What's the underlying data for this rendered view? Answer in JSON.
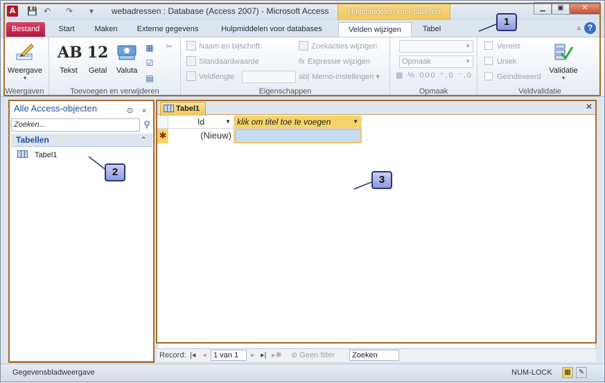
{
  "titlebar": {
    "app_icon": "A",
    "title": "webadressen : Database (Access 2007)  -  Microsoft Access",
    "context_header": "Hulpmiddelen voor tabellen",
    "window_buttons": {
      "minimize": "▁",
      "restore": "▣",
      "close": "✕"
    }
  },
  "tabs": {
    "file": "Bestand",
    "start": "Start",
    "create": "Maken",
    "external": "Externe gegevens",
    "db_tools": "Hulpmiddelen voor databases",
    "fields": "Velden wijzigen",
    "table": "Tabel"
  },
  "ribbon": {
    "views": {
      "view": "Weergave",
      "group": "Weergaven"
    },
    "add_delete": {
      "text": "Tekst",
      "number": "Getal",
      "currency": "Valuta",
      "group": "Toevoegen en verwijderen"
    },
    "properties": {
      "name_caption": "Naam en bijschrift",
      "default_value": "Standaardwaarde",
      "field_size": "Veldlengte",
      "lookups": "Zoekacties wijzigen",
      "expression": "Expressie wijzigen",
      "memo": "Memo-instellingen",
      "group": "Eigenschappen"
    },
    "formatting": {
      "format_label": "Opmaak",
      "percent": "%",
      "thousands": "000",
      "group": "Opmaak"
    },
    "validation": {
      "required": "Vereist",
      "unique": "Uniek",
      "indexed": "Geïndexeerd",
      "validation_btn": "Validatie",
      "group": "Veldvalidatie"
    }
  },
  "callouts": [
    "1",
    "2",
    "3"
  ],
  "nav": {
    "header": "Alle Access-objecten",
    "search_placeholder": "Zoeken...",
    "section": "Tabellen",
    "items": [
      {
        "label": "Tabel1"
      }
    ]
  },
  "doc": {
    "tab": "Tabel1",
    "columns": {
      "id": "Id",
      "new": "klik om titel toe te voegen"
    },
    "row": {
      "marker": "✱",
      "id": "(Nieuw)"
    }
  },
  "recordbar": {
    "label": "Record:",
    "position": "1 van 1",
    "filter": "Geen filter",
    "search": "Zoeken"
  },
  "statusbar": {
    "view_name": "Gegevensbladweergave",
    "numlock": "NUM-LOCK"
  }
}
